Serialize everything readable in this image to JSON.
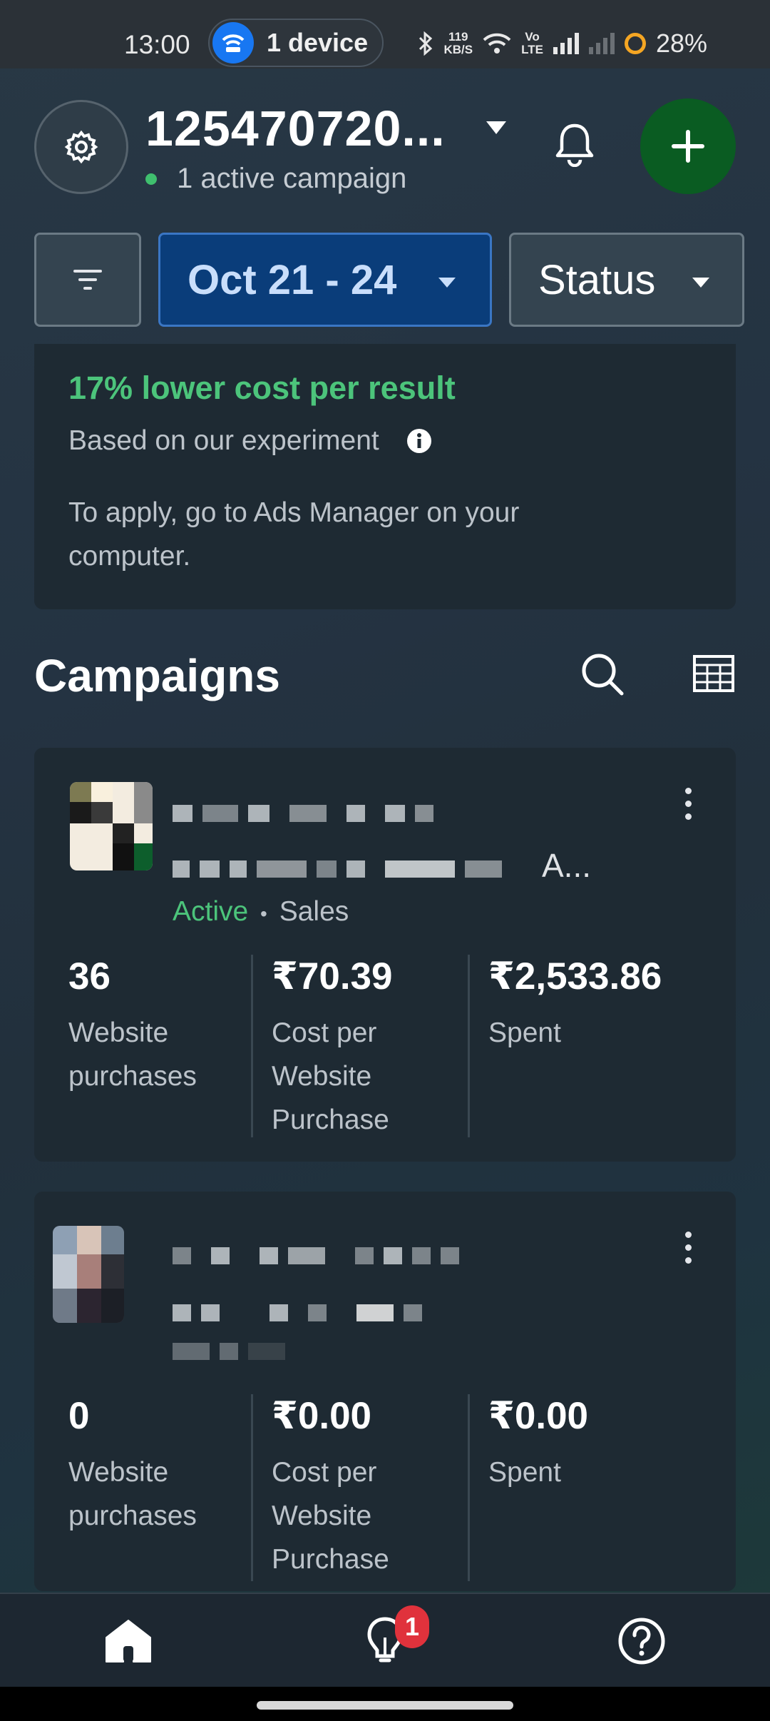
{
  "status_bar": {
    "time": "13:00",
    "pill_label": "1 device",
    "net_speed_value": "119",
    "net_speed_unit": "KB/S",
    "volte_top": "Vo",
    "volte_bottom": "LTE",
    "battery": "28%"
  },
  "header": {
    "account_id": "125470720...",
    "active_campaigns": "1 active campaign"
  },
  "filters": {
    "date_range": "Oct 21 - 24",
    "status": "Status"
  },
  "tip_card": {
    "headline": "17% lower cost per result",
    "subtitle": "Based on our experiment",
    "body": "To apply, go to Ads Manager on your computer."
  },
  "campaigns": {
    "title": "Campaigns",
    "items": [
      {
        "name_trailing": "A...",
        "status": "Active",
        "separator": "•",
        "objective": "Sales",
        "metrics": [
          {
            "value": "36",
            "label": "Website purchases"
          },
          {
            "value": "₹70.39",
            "label": "Cost per Website Purchase"
          },
          {
            "value": "₹2,533.86",
            "label": "Spent"
          }
        ]
      },
      {
        "metrics": [
          {
            "value": "0",
            "label": "Website purchases"
          },
          {
            "value": "₹0.00",
            "label": "Cost per Website Purchase"
          },
          {
            "value": "₹0.00",
            "label": "Spent"
          }
        ]
      }
    ]
  },
  "bottom_nav": {
    "tips_badge": "1"
  },
  "colors": {
    "accent_green": "#4cc47b",
    "date_chip_bg": "#0a3d7a",
    "add_button_bg": "#0a5c22",
    "badge_red": "#e0323c"
  }
}
